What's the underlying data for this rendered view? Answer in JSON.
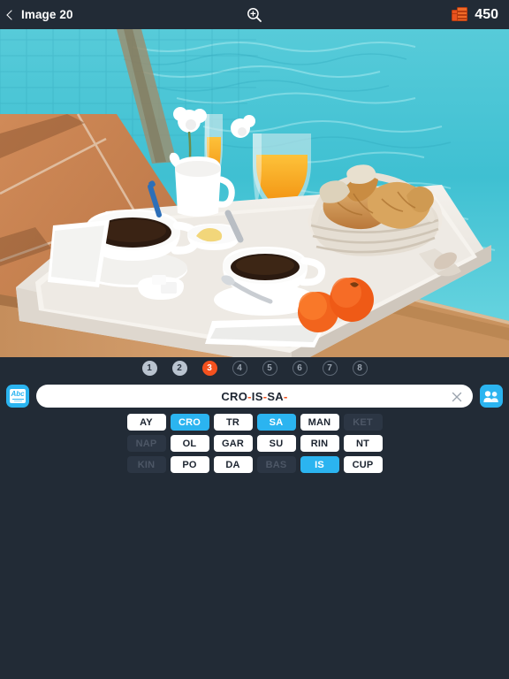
{
  "topbar": {
    "back_label": "Image 20",
    "back_icon": "chevron-left-icon",
    "zoom_icon": "magnifier-plus-icon",
    "coin_icon": "coin-stack-icon",
    "coin_count": "450"
  },
  "photo": {
    "alt": "Poolside breakfast tray with coffee cups, orange juice, croissants in a wicker basket and tangerines beside a turquoise swimming pool",
    "colors": {
      "pool_water": "#4cc8d8",
      "pool_water_light": "#8fe0e8",
      "terracotta_tile": "#c98050",
      "lounger_wood": "#c08a55",
      "tray_white": "#f0ece6",
      "juice_orange": "#f7a81b",
      "croissant": "#d9a05a",
      "tangerine": "#f05a20",
      "coffee_dark": "#2a1a0f"
    }
  },
  "progress": {
    "dots": [
      {
        "label": "1",
        "state": "solved"
      },
      {
        "label": "2",
        "state": "solved"
      },
      {
        "label": "3",
        "state": "active"
      },
      {
        "label": "4",
        "state": "empty"
      },
      {
        "label": "5",
        "state": "empty"
      },
      {
        "label": "6",
        "state": "empty"
      },
      {
        "label": "7",
        "state": "empty"
      },
      {
        "label": "8",
        "state": "empty"
      }
    ]
  },
  "answer": {
    "hint_icon": "abc-dictionary-icon",
    "friends_icon": "two-people-icon",
    "clear_icon": "close-x-icon",
    "syllables": [
      "CRO",
      "IS",
      "SA"
    ],
    "separator": "-",
    "trailing_separator": "-",
    "display": "CRO-IS-SA-",
    "accent_color": "#f4511e",
    "button_color": "#2bb4f0"
  },
  "tiles": {
    "rows": [
      [
        {
          "label": "AY",
          "state": "available"
        },
        {
          "label": "CRO",
          "state": "selected"
        },
        {
          "label": "TR",
          "state": "available"
        },
        {
          "label": "SA",
          "state": "selected"
        },
        {
          "label": "MAN",
          "state": "available"
        },
        {
          "label": "KET",
          "state": "used"
        }
      ],
      [
        {
          "label": "NAP",
          "state": "used"
        },
        {
          "label": "OL",
          "state": "available"
        },
        {
          "label": "GAR",
          "state": "available"
        },
        {
          "label": "SU",
          "state": "available"
        },
        {
          "label": "RIN",
          "state": "available"
        },
        {
          "label": "NT",
          "state": "available"
        }
      ],
      [
        {
          "label": "KIN",
          "state": "used"
        },
        {
          "label": "PO",
          "state": "available"
        },
        {
          "label": "DA",
          "state": "available"
        },
        {
          "label": "BAS",
          "state": "used"
        },
        {
          "label": "IS",
          "state": "selected"
        },
        {
          "label": "CUP",
          "state": "available"
        }
      ]
    ]
  }
}
